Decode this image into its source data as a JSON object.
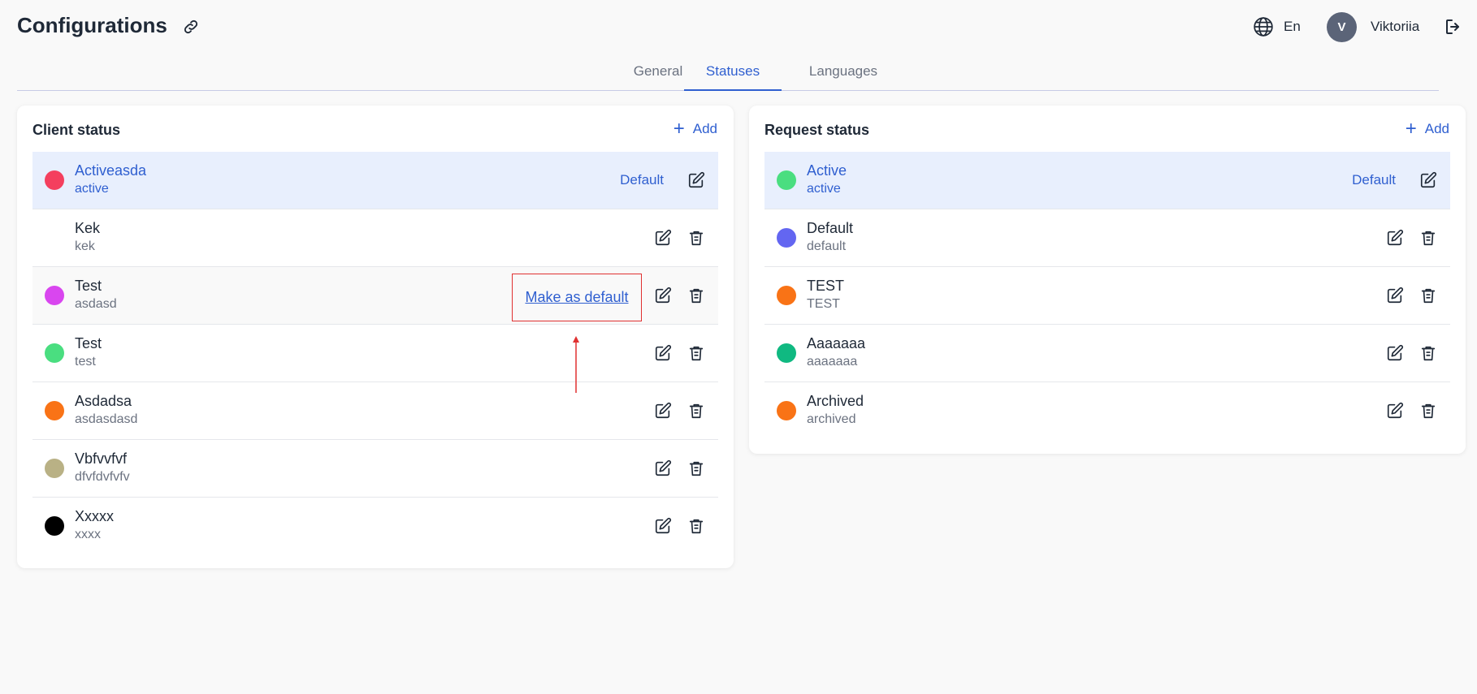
{
  "header": {
    "title": "Configurations",
    "language": "En",
    "user_initial": "V",
    "user_name": "Viktoriia"
  },
  "tabs": [
    {
      "label": "General",
      "active": false
    },
    {
      "label": "Statuses",
      "active": true
    },
    {
      "label": "Languages",
      "active": false
    }
  ],
  "client_status": {
    "title": "Client status",
    "add_label": "Add",
    "default_label": "Default",
    "make_default_label": "Make as default",
    "rows": [
      {
        "name": "Activeasda",
        "code": "active",
        "color": "#f43f5e",
        "is_default": true
      },
      {
        "name": "Kek",
        "code": "kek",
        "color": "",
        "is_default": false
      },
      {
        "name": "Test",
        "code": "asdasd",
        "color": "#d946ef",
        "is_default": false
      },
      {
        "name": "Test",
        "code": "test",
        "color": "#4ade80",
        "is_default": false
      },
      {
        "name": "Asdadsa",
        "code": "asdasdasd",
        "color": "#f97316",
        "is_default": false
      },
      {
        "name": "Vbfvvfvf",
        "code": "dfvfdvfvfv",
        "color": "#b9b185",
        "is_default": false
      },
      {
        "name": "Xxxxx",
        "code": "xxxx",
        "color": "#000000",
        "is_default": false
      }
    ]
  },
  "request_status": {
    "title": "Request status",
    "add_label": "Add",
    "default_label": "Default",
    "rows": [
      {
        "name": "Active",
        "code": "active",
        "color": "#4ade80",
        "is_default": true
      },
      {
        "name": "Default",
        "code": "default",
        "color": "#6366f1",
        "is_default": false
      },
      {
        "name": "TEST",
        "code": "TEST",
        "color": "#f97316",
        "is_default": false
      },
      {
        "name": "Aaaaaaa",
        "code": "aaaaaaa",
        "color": "#10b981",
        "is_default": false
      },
      {
        "name": "Archived",
        "code": "archived",
        "color": "#f97316",
        "is_default": false
      }
    ]
  },
  "colors": {
    "accent": "#2f5fd0",
    "highlight": "#e03131",
    "default_row_bg": "#e8effd"
  }
}
